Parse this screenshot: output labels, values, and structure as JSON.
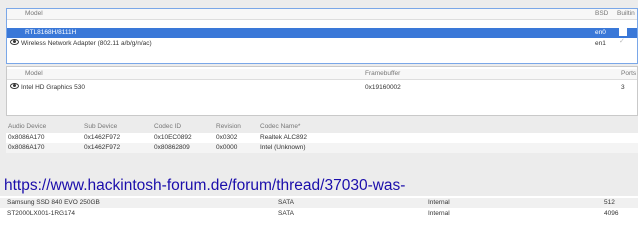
{
  "network": {
    "headers": [
      "Model",
      "BSD",
      "Builtin"
    ],
    "rows": [
      {
        "model": "RTL8168H/8111H",
        "bsd": "en0",
        "selected": true
      },
      {
        "model": "Wireless Network Adapter (802.11 a/b/g/n/ac)",
        "bsd": "en1",
        "selected": false
      }
    ]
  },
  "graphics": {
    "headers": [
      "Model",
      "Framebuffer",
      "Ports"
    ],
    "rows": [
      {
        "model": "Intel HD Graphics 530",
        "framebuffer": "0x19160002",
        "ports": "3"
      }
    ]
  },
  "audio": {
    "headers": [
      "Audio Device",
      "Sub Device",
      "Codec ID",
      "Revision",
      "Codec Name*"
    ],
    "rows": [
      {
        "device": "0x8086A170",
        "sub": "0x1462F972",
        "codec_id": "0x10EC0892",
        "rev": "0x0302",
        "name": "Realtek ALC892"
      },
      {
        "device": "0x8086A170",
        "sub": "0x1462F972",
        "codec_id": "0x80862809",
        "rev": "0x0000",
        "name": "Intel (Unknown)"
      }
    ]
  },
  "watermark_url": "https://www.hackintosh-forum.de/forum/thread/37030-was-",
  "storage": {
    "rows": [
      {
        "model": "Samsung SSD 840 EVO 250GB",
        "type": "SATA",
        "location": "Internal",
        "size": "512"
      },
      {
        "model": "ST2000LX001-1RG174",
        "type": "SATA",
        "location": "Internal",
        "size": "4096"
      }
    ]
  }
}
